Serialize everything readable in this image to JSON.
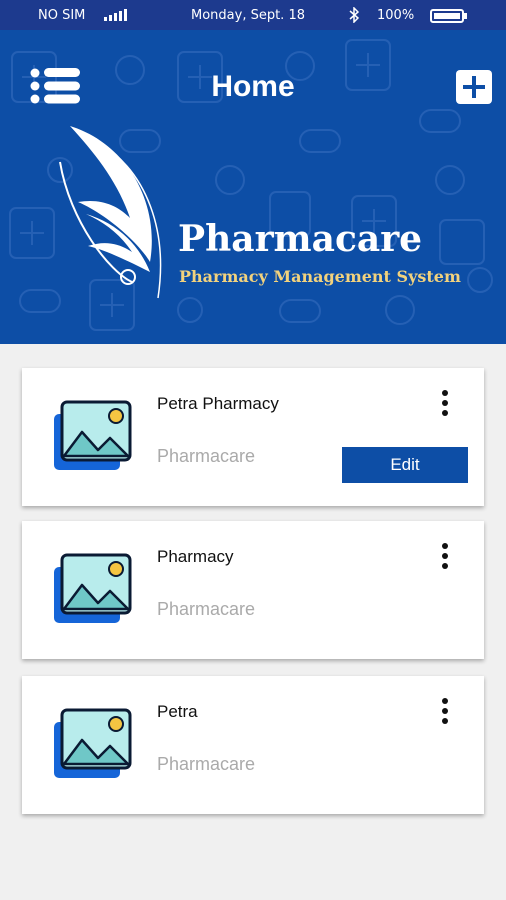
{
  "status_bar": {
    "carrier": "NO SIM",
    "date": "Monday, Sept. 18",
    "battery": "100%"
  },
  "header": {
    "title": "Home",
    "brand_name": "Pharmacare",
    "brand_tagline": "Pharmacy Management System"
  },
  "pharmacies": [
    {
      "title": "Petra Pharmacy",
      "subtitle": "Pharmacare",
      "edit_label": "Edit"
    },
    {
      "title": "Pharmacy",
      "subtitle": "Pharmacare"
    },
    {
      "title": "Petra",
      "subtitle": "Pharmacare"
    }
  ],
  "colors": {
    "primary": "#0d4ea6",
    "status_bar": "#1d3a8e",
    "tagline": "#f2d27d",
    "background": "#f0f0f0"
  },
  "icons": [
    "signal-icon",
    "bluetooth-icon",
    "battery-icon",
    "menu-icon",
    "plus-icon",
    "image-icon",
    "more-vertical-icon"
  ]
}
